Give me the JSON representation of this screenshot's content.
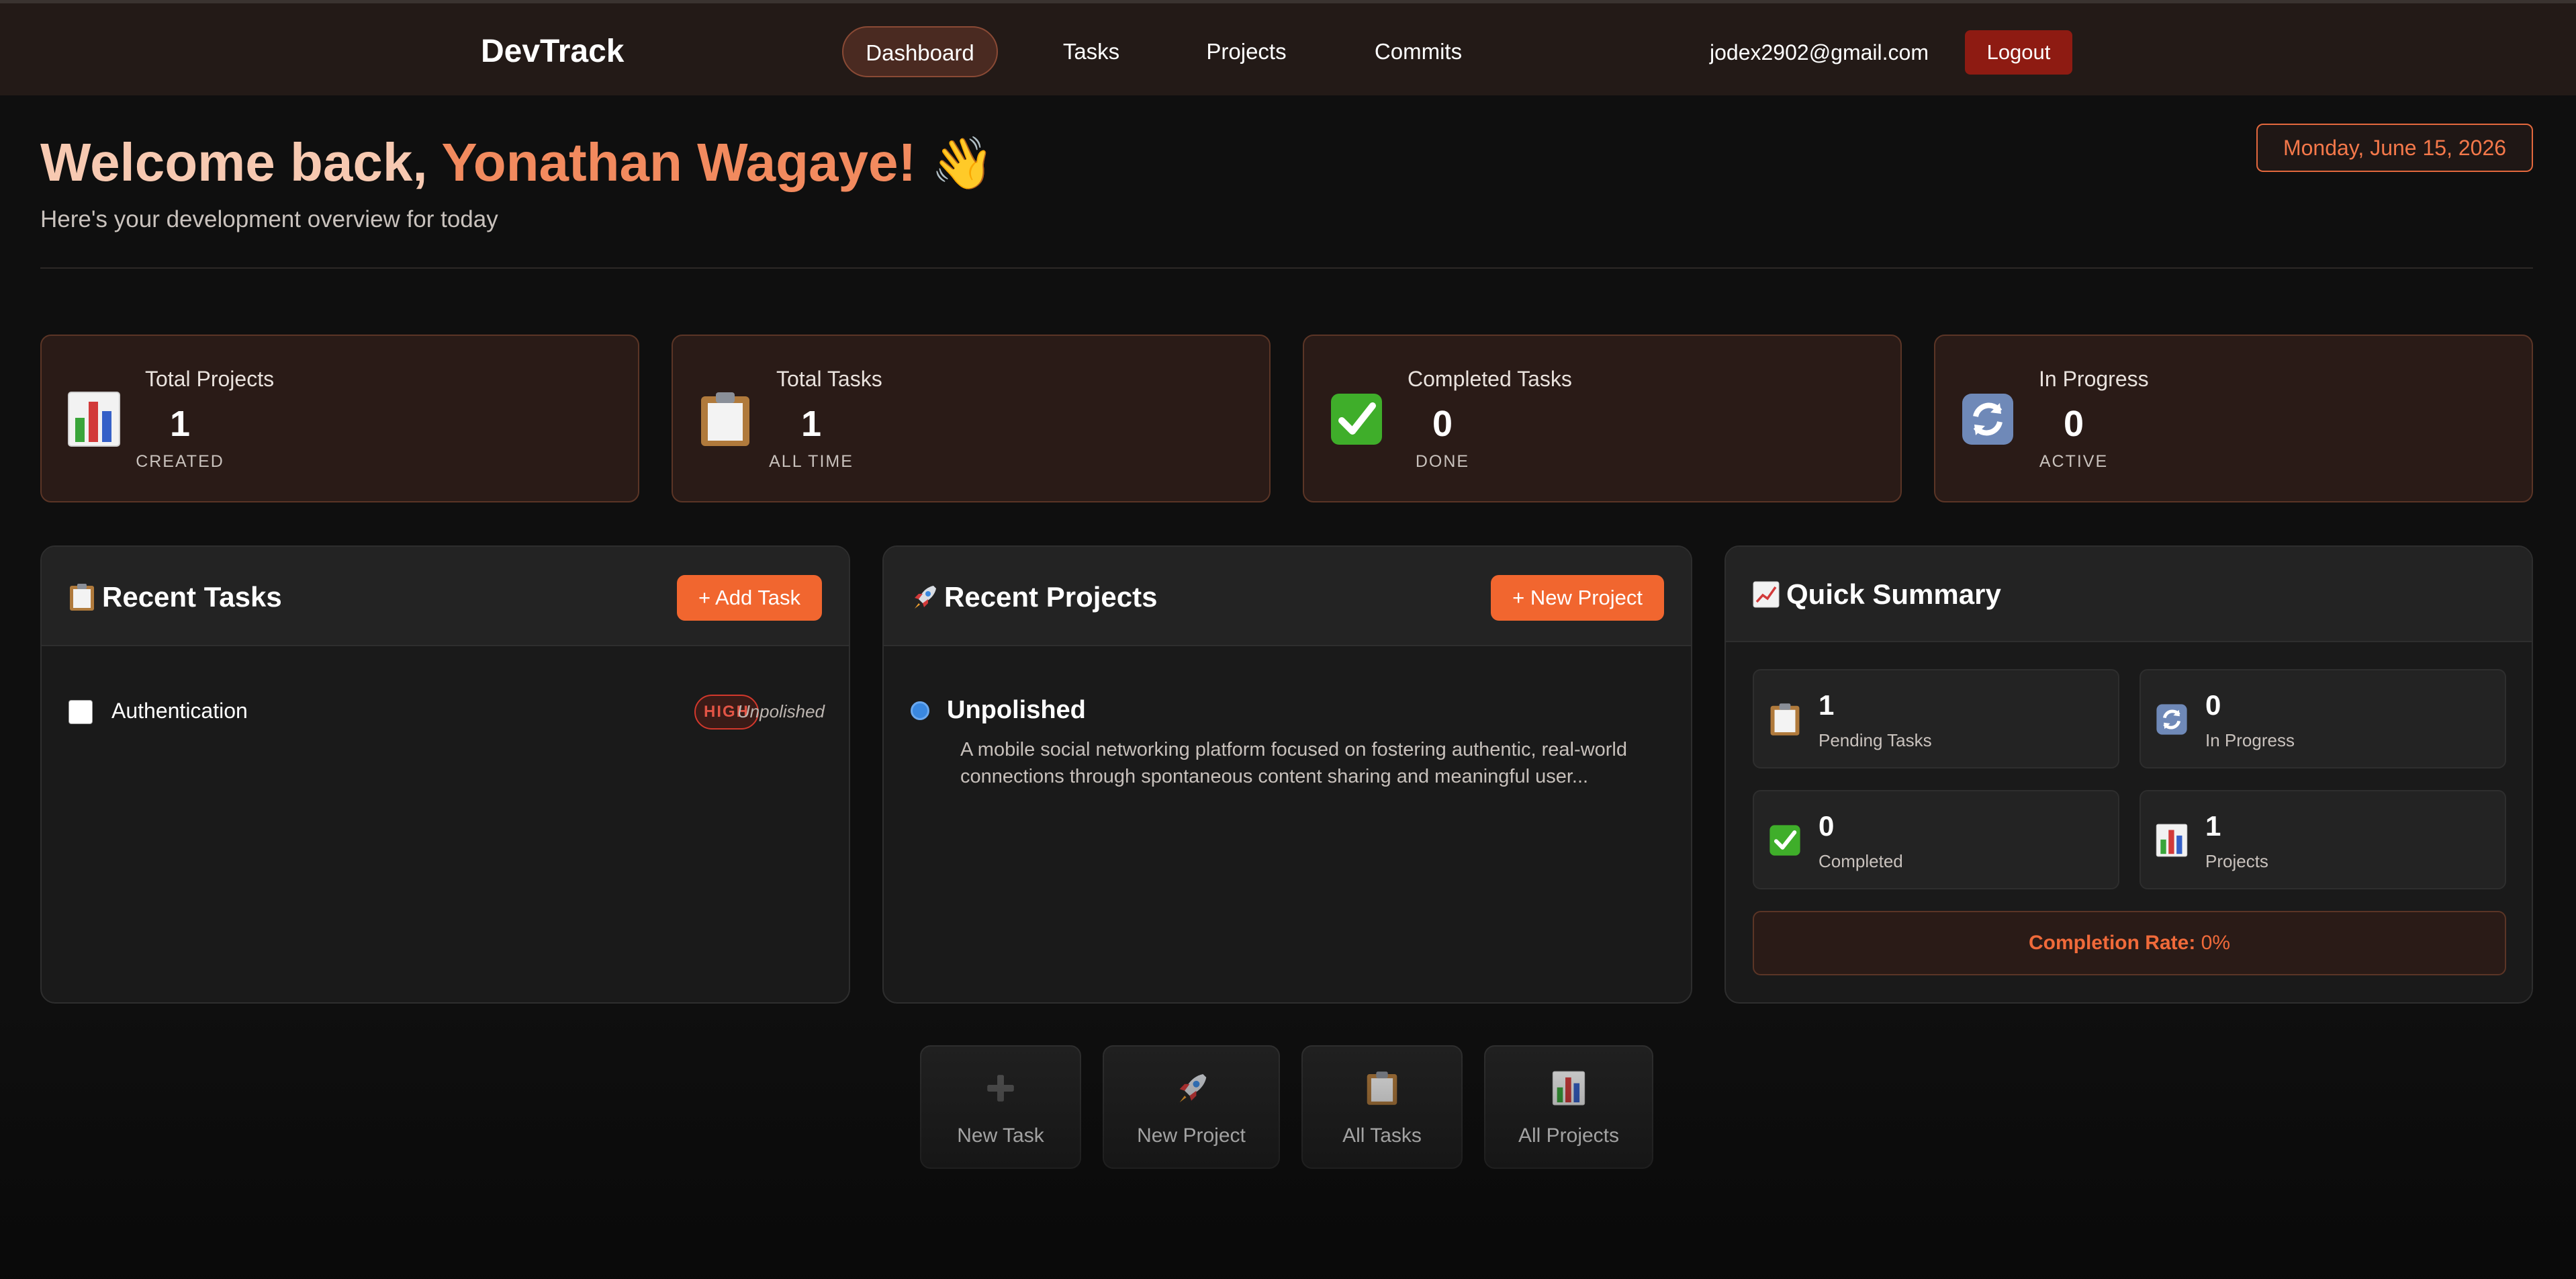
{
  "nav": {
    "brand": "DevTrack",
    "links": [
      {
        "label": "Dashboard",
        "active": true
      },
      {
        "label": "Tasks",
        "active": false
      },
      {
        "label": "Projects",
        "active": false
      },
      {
        "label": "Commits",
        "active": false
      }
    ],
    "user_email": "jodex2902@gmail.com",
    "logout_label": "Logout"
  },
  "header": {
    "welcome_prefix": "Welcome back, ",
    "user_name": "Yonathan Wagaye!",
    "wave_emoji": "👋",
    "subtitle": "Here's your development overview for today",
    "date": "Monday, June 15, 2026"
  },
  "stats": [
    {
      "icon": "bar-chart-icon",
      "title": "Total Projects",
      "value": "1",
      "sub": "CREATED"
    },
    {
      "icon": "clipboard-icon",
      "title": "Total Tasks",
      "value": "1",
      "sub": "ALL TIME"
    },
    {
      "icon": "check-mark-icon",
      "title": "Completed Tasks",
      "value": "0",
      "sub": "DONE"
    },
    {
      "icon": "refresh-icon",
      "title": "In Progress",
      "value": "0",
      "sub": "ACTIVE"
    }
  ],
  "recent_tasks": {
    "title": "Recent Tasks",
    "add_label": "+ Add Task",
    "items": [
      {
        "name": "Authentication",
        "priority": "HIGH",
        "project": "Unpolished"
      }
    ]
  },
  "recent_projects": {
    "title": "Recent Projects",
    "new_label": "+ New Project",
    "items": [
      {
        "name": "Unpolished",
        "description": "A mobile social networking platform focused on fostering authentic, real-world connections through spontaneous content sharing and meaningful user..."
      }
    ]
  },
  "summary": {
    "title": "Quick Summary",
    "tiles": [
      {
        "icon": "clipboard-icon",
        "value": "1",
        "label": "Pending Tasks"
      },
      {
        "icon": "refresh-icon",
        "value": "0",
        "label": "In Progress"
      },
      {
        "icon": "check-mark-icon",
        "value": "0",
        "label": "Completed"
      },
      {
        "icon": "bar-chart-icon",
        "value": "1",
        "label": "Projects"
      }
    ],
    "completion_label": "Completion Rate:",
    "completion_value": "0%"
  },
  "quick_actions": [
    {
      "icon": "plus-icon",
      "label": "New Task"
    },
    {
      "icon": "rocket-icon",
      "label": "New Project"
    },
    {
      "icon": "clipboard-icon",
      "label": "All Tasks"
    },
    {
      "icon": "bar-chart-icon",
      "label": "All Projects"
    }
  ],
  "colors": {
    "accent": "#f1662f",
    "accent_text": "#f28a5e",
    "logout": "#8e1b12",
    "priority_high": "#d2382c",
    "project_dot": "#3a88e0",
    "card_bg": "#2a1b17",
    "panel_bg": "#1a1a1a"
  }
}
